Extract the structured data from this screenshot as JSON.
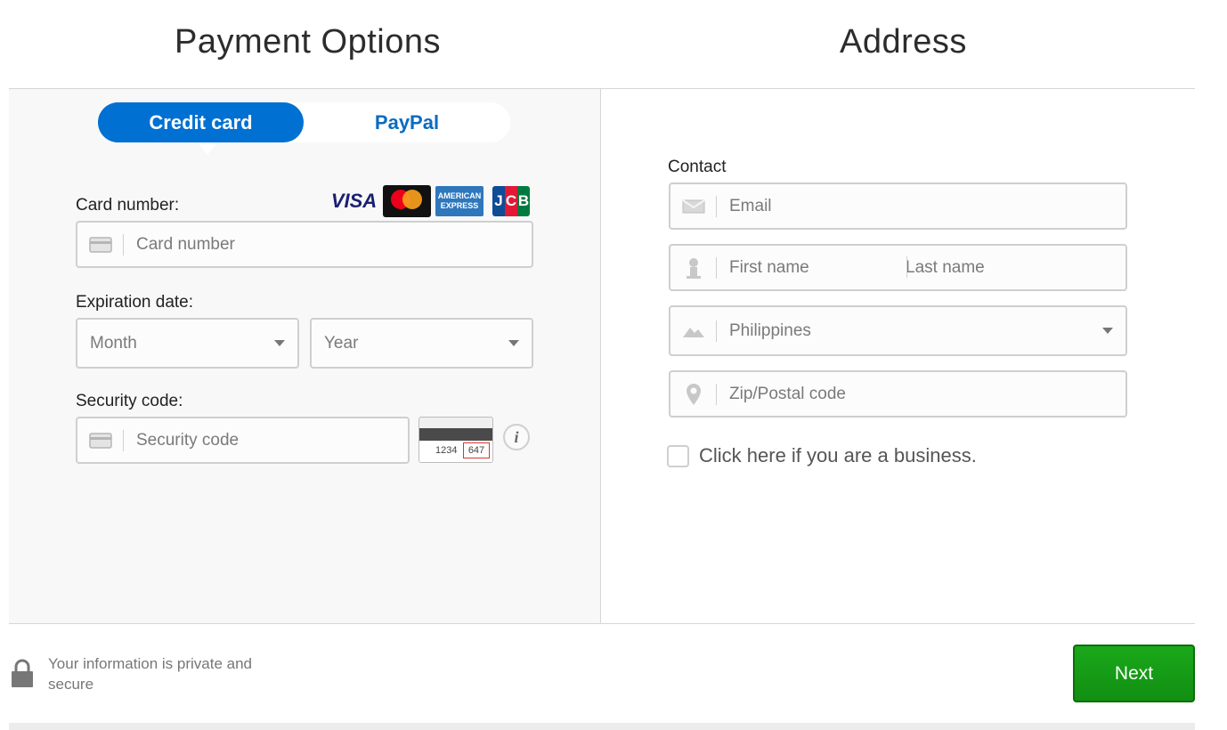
{
  "header": {
    "payment_title": "Payment Options",
    "address_title": "Address"
  },
  "payment": {
    "tabs": [
      {
        "label": "Credit card",
        "selected": true
      },
      {
        "label": "PayPal",
        "selected": false
      }
    ],
    "card_logos": {
      "visa": "VISA",
      "amex_line1": "AMERICAN",
      "amex_line2": "EXPRESS",
      "jcb": [
        "J",
        "C",
        "B"
      ]
    },
    "card_number_label": "Card number:",
    "card_number_placeholder": "Card number",
    "expiration_label": "Expiration date:",
    "month_value": "Month",
    "year_value": "Year",
    "security_label": "Security code:",
    "security_placeholder": "Security code",
    "cvv_example_number": "1234",
    "cvv_example_code": "647",
    "info_glyph": "i"
  },
  "address": {
    "contact_label": "Contact",
    "email_placeholder": "Email",
    "first_name_placeholder": "First name",
    "last_name_placeholder": "Last name",
    "country_value": "Philippines",
    "zip_placeholder": "Zip/Postal code",
    "business_checkbox_label": "Click here if you are a business."
  },
  "footer": {
    "secure_text": "Your information is private and secure",
    "next_label": "Next"
  },
  "colors": {
    "primary_blue": "#0070d2",
    "next_green": "#139713",
    "panel_bg": "#f8f8f8"
  }
}
